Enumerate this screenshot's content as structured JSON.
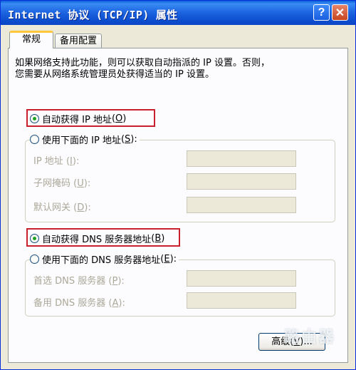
{
  "window": {
    "title": "Internet 协议 (TCP/IP) 属性",
    "help_glyph": "?",
    "close_glyph": "✕"
  },
  "tabs": [
    {
      "label": "常规",
      "selected": true
    },
    {
      "label": "备用配置",
      "selected": false
    }
  ],
  "description": "如果网络支持此功能，则可以获取自动指派的 IP 设置。否则，\n您需要从网络系统管理员处获得适当的 IP 设置。",
  "ip_section": {
    "auto": {
      "label": "自动获得 IP 地址",
      "key": "O",
      "checked": true
    },
    "manual": {
      "label": "使用下面的 IP 地址",
      "key": "S",
      "checked": false
    },
    "fields": [
      {
        "label": "IP 地址",
        "key": "I",
        "value": ""
      },
      {
        "label": "子网掩码",
        "key": "U",
        "value": ""
      },
      {
        "label": "默认网关",
        "key": "D",
        "value": ""
      }
    ]
  },
  "dns_section": {
    "auto": {
      "label": "自动获得 DNS 服务器地址",
      "key": "B",
      "checked": true
    },
    "manual": {
      "label": "使用下面的 DNS 服务器地址",
      "key": "E",
      "checked": false
    },
    "fields": [
      {
        "label": "首选 DNS 服务器",
        "key": "P",
        "value": ""
      },
      {
        "label": "备用 DNS 服务器",
        "key": "A",
        "value": ""
      }
    ]
  },
  "advanced_button": {
    "label": "高级",
    "key": "V",
    "suffix": "..."
  },
  "watermark": "路由器",
  "colors": {
    "highlight": "#c8202c",
    "titlebar": "#1e67e2"
  }
}
